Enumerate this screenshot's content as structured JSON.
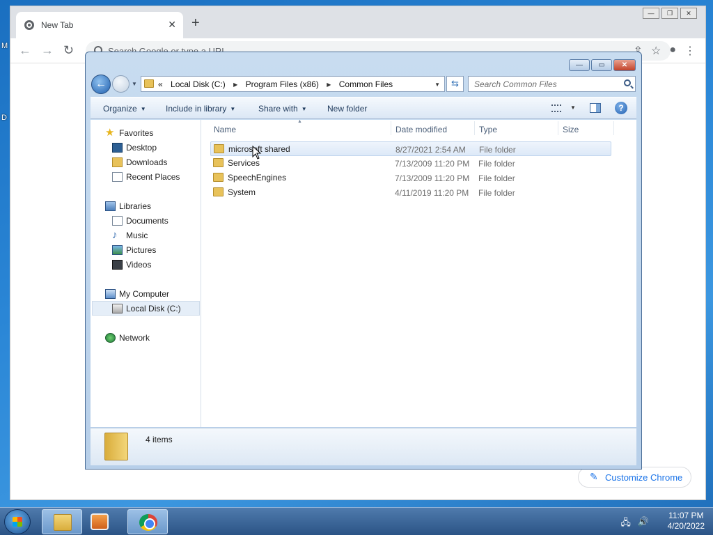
{
  "desktop": {
    "label_m": "M",
    "label_d": "D"
  },
  "chrome": {
    "tab_title": "New Tab",
    "tab_close": "✕",
    "new_tab": "+",
    "back": "←",
    "forward": "→",
    "reload": "↻",
    "omnibox_placeholder": "Search Google or type a URL",
    "share": "⇪",
    "bookmark": "☆",
    "profile": "●",
    "menu": "⋮",
    "minimize": "—",
    "restore": "❐",
    "close": "✕",
    "customize_label": "Customize Chrome",
    "customize_icon": "✎"
  },
  "explorer": {
    "caption": {
      "minimize": "—",
      "maximize": "▭",
      "close": "✕"
    },
    "back": "←",
    "history_dropdown": "▼",
    "address": {
      "prefix": "«",
      "crumbs": [
        "Local Disk (C:)",
        "Program Files (x86)",
        "Common Files"
      ],
      "separator": "▶",
      "dropdown": "▼"
    },
    "refresh": "⇆",
    "search_placeholder": "Search Common Files",
    "commands": {
      "organize": "Organize",
      "include": "Include in library",
      "share": "Share with",
      "new_folder": "New folder",
      "arrow": "▼",
      "help": "?"
    },
    "nav": {
      "favorites": "Favorites",
      "desktop": "Desktop",
      "downloads": "Downloads",
      "recent": "Recent Places",
      "libraries": "Libraries",
      "documents": "Documents",
      "music": "Music",
      "pictures": "Pictures",
      "videos": "Videos",
      "computer": "My Computer",
      "localdisk": "Local Disk (C:)",
      "network": "Network",
      "music_glyph": "♪",
      "star_glyph": "★"
    },
    "columns": {
      "name": "Name",
      "date": "Date modified",
      "type": "Type",
      "size": "Size",
      "sort_glyph": "▲"
    },
    "files": [
      {
        "name": "microsoft shared",
        "date": "8/27/2021 2:54 AM",
        "type": "File folder"
      },
      {
        "name": "Services",
        "date": "7/13/2009 11:20 PM",
        "type": "File folder"
      },
      {
        "name": "SpeechEngines",
        "date": "7/13/2009 11:20 PM",
        "type": "File folder"
      },
      {
        "name": "System",
        "date": "4/11/2019 11:20 PM",
        "type": "File folder"
      }
    ],
    "status": "4 items"
  },
  "taskbar": {
    "time": "11:07 PM",
    "date": "4/20/2022",
    "tray_network": "🖧",
    "tray_volume": "🔊"
  }
}
